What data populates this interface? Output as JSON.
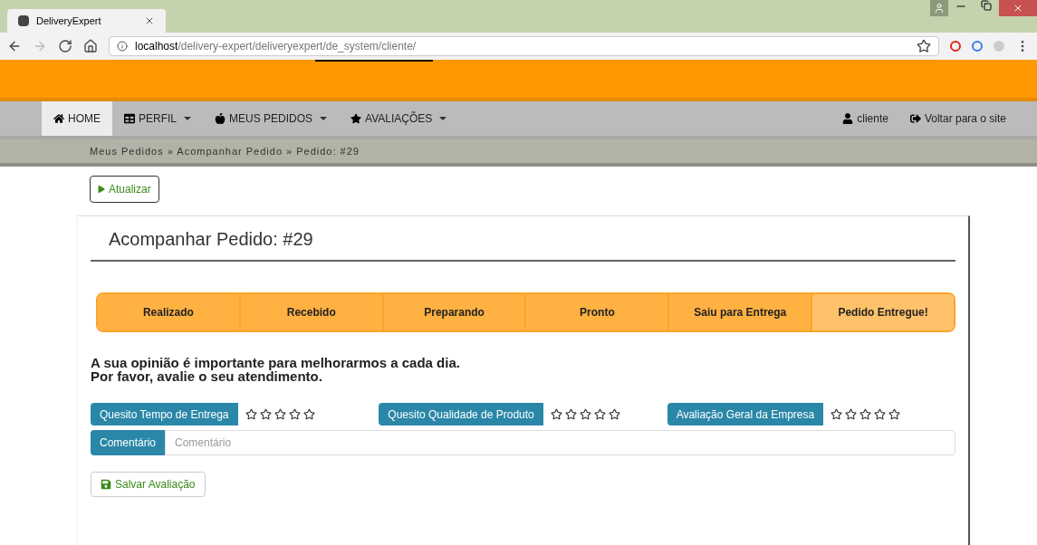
{
  "browser": {
    "tab_title": "DeliveryExpert",
    "url_host": "localhost",
    "url_path": "/delivery-expert/deliveryexpert/de_system/cliente/"
  },
  "nav": {
    "items": [
      {
        "label": "HOME",
        "kind": "home",
        "dropdown": false,
        "selected": true
      },
      {
        "label": "PERFIL",
        "kind": "table",
        "dropdown": true,
        "selected": false
      },
      {
        "label": "MEUS PEDIDOS",
        "kind": "apple",
        "dropdown": true,
        "selected": false
      },
      {
        "label": "AVALIAÇÕES",
        "kind": "star",
        "dropdown": true,
        "selected": false
      }
    ],
    "right": [
      {
        "label": "cliente",
        "kind": "user"
      },
      {
        "label": "Voltar para o site",
        "kind": "exit"
      }
    ]
  },
  "breadcrumb": "Meus Pedidos » Acompanhar Pedido » Pedido: #29",
  "refresh_button": "Atualizar",
  "title": "Acompanhar Pedido: #29",
  "steps": [
    {
      "label": "Realizado",
      "selected": false
    },
    {
      "label": "Recebido",
      "selected": false
    },
    {
      "label": "Preparando",
      "selected": false
    },
    {
      "label": "Pronto",
      "selected": false
    },
    {
      "label": "Saiu para Entrega",
      "selected": false
    },
    {
      "label": "Pedido Entregue!",
      "selected": true
    }
  ],
  "message": [
    "A sua opinião é importante para melhorarmos a cada dia.",
    "Por favor, avalie o seu atendimento."
  ],
  "ratings": [
    {
      "label": "Quesito Tempo de Entrega",
      "stars": 0
    },
    {
      "label": "Quesito Qualidade de Produto",
      "stars": 0
    },
    {
      "label": "Avaliação Geral da Empresa",
      "stars": 0
    }
  ],
  "comment": {
    "label": "Comentário",
    "placeholder": "Comentário"
  },
  "save_button": "Salvar Avaliação"
}
